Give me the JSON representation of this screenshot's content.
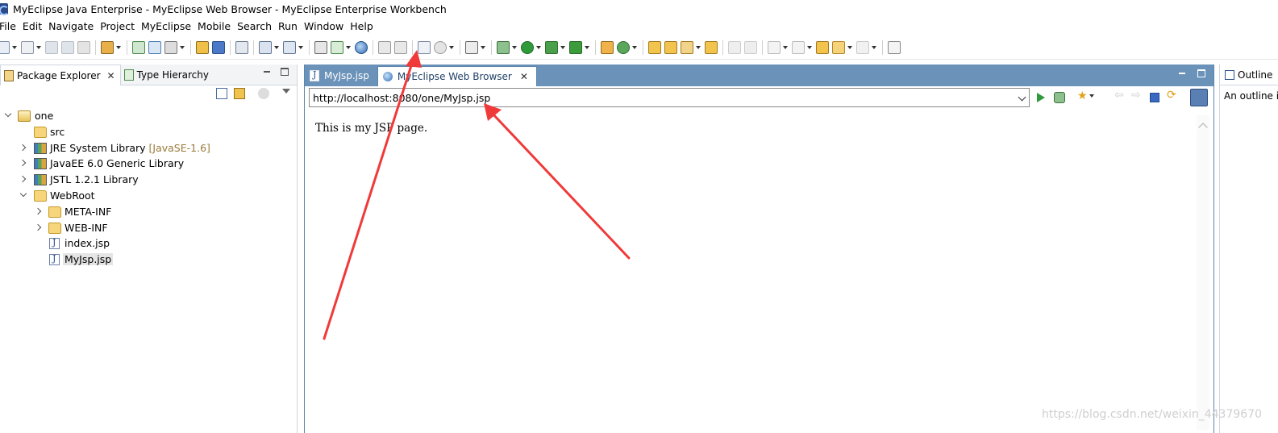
{
  "window": {
    "title": "MyEclipse Java Enterprise - MyEclipse Web Browser - MyEclipse Enterprise Workbench"
  },
  "menu": [
    "File",
    "Edit",
    "Navigate",
    "Project",
    "MyEclipse",
    "Mobile",
    "Search",
    "Run",
    "Window",
    "Help"
  ],
  "left_panel": {
    "tabs": [
      {
        "label": "Package Explorer",
        "active": true,
        "icon": "package-explorer-icon"
      },
      {
        "label": "Type Hierarchy",
        "active": false,
        "icon": "type-hierarchy-icon"
      }
    ],
    "tree": [
      {
        "label": "one",
        "hint": "",
        "icon": "project-icon",
        "expanded": true
      },
      {
        "label": "src",
        "hint": "",
        "icon": "source-folder-icon"
      },
      {
        "label": "JRE System Library",
        "hint": " [JavaSE-1.6]",
        "icon": "library-icon",
        "expanded": false
      },
      {
        "label": "JavaEE 6.0 Generic Library",
        "hint": "",
        "icon": "library-icon",
        "expanded": false
      },
      {
        "label": "JSTL 1.2.1 Library",
        "hint": "",
        "icon": "library-icon",
        "expanded": false
      },
      {
        "label": "WebRoot",
        "hint": "",
        "icon": "folder-icon",
        "expanded": true
      },
      {
        "label": "META-INF",
        "hint": "",
        "icon": "folder-icon",
        "expanded": false
      },
      {
        "label": "WEB-INF",
        "hint": "",
        "icon": "folder-icon",
        "expanded": false
      },
      {
        "label": "index.jsp",
        "hint": "",
        "icon": "jsp-file-icon"
      },
      {
        "label": "MyJsp.jsp",
        "hint": "",
        "icon": "jsp-file-icon",
        "selected": true
      }
    ]
  },
  "editor": {
    "tabs": [
      {
        "label": "MyJsp.jsp",
        "active": false,
        "icon": "jsp-file-icon"
      },
      {
        "label": "MyEclipse Web Browser",
        "active": true,
        "icon": "globe-icon"
      }
    ],
    "url": "http://localhost:8080/one/MyJsp.jsp",
    "page_text": "This is my JSP page."
  },
  "right_panel": {
    "tab_label": "Outline",
    "message": "An outline is not available."
  },
  "watermark": "https://blog.csdn.net/weixin_44379670",
  "colors": {
    "editor_tab_bar": "#6b92b8",
    "annotation_arrow": "#f03a3a",
    "library_hint": "#9a7b3a"
  }
}
